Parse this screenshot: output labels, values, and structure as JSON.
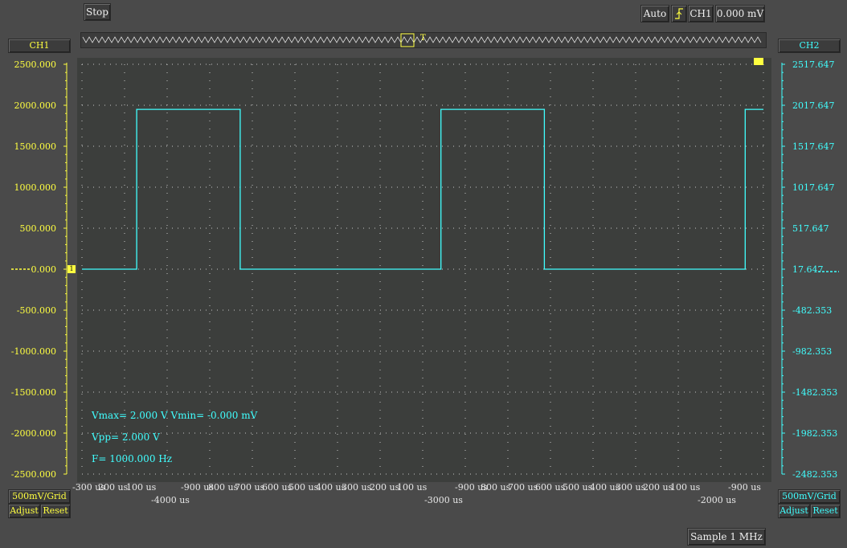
{
  "toolbar": {
    "stop_label": "Stop",
    "trigger_mode": "Auto",
    "trigger_edge_icon": "rising-edge-icon",
    "trigger_source": "CH1",
    "trigger_level": "0.000 mV"
  },
  "channels": {
    "ch1": {
      "label": "CH1",
      "scale": "500mV/Grid",
      "adjust": "Adjust",
      "reset": "Reset",
      "color": "#ffff40",
      "offset_marker": "1"
    },
    "ch2": {
      "label": "CH2",
      "scale": "500mV/Grid",
      "adjust": "Adjust",
      "reset": "Reset",
      "color": "#40ffff"
    }
  },
  "y_axis_left": [
    "2500.000",
    "2000.000",
    "1500.000",
    "1000.000",
    "500.000",
    "0.000",
    "-500.000",
    "-1000.000",
    "-1500.000",
    "-2000.000",
    "-2500.000"
  ],
  "y_axis_right": [
    "2517.647",
    "2017.647",
    "1517.647",
    "1017.647",
    "517.647",
    "17.647",
    "-482.353",
    "-982.353",
    "-1482.353",
    "-1982.353",
    "-2482.353"
  ],
  "x_axis_top": [
    "-300 us",
    "200 us",
    "100 us",
    "-900 us",
    "800 us",
    "700 us",
    "600 us",
    "500 us",
    "400 us",
    "300 us",
    "200 us",
    "100 us",
    "-900 us",
    "800 us",
    "700 us",
    "600 us",
    "500 us",
    "400 us",
    "300 us",
    "200 us",
    "100 us",
    "-900 us"
  ],
  "x_axis_major": [
    "-4000 us",
    "-3000 us",
    "-2000 us"
  ],
  "measurements": {
    "vmax_vmin": "Vmax= 2.000 V  Vmin= -0.000 mV",
    "vpp": "Vpp= 2.000 V",
    "freq": "F= 1000.000 Hz"
  },
  "status": {
    "sample_rate": "Sample 1 MHz"
  },
  "chart_data": {
    "type": "line",
    "series": [
      {
        "name": "CH1",
        "color": "#40ffff",
        "x": [
          -4320,
          -4140,
          -4140,
          -3800,
          -3800,
          -3140,
          -3140,
          -2800,
          -2800,
          -2140,
          -2140,
          -2080
        ],
        "y": [
          0,
          0,
          1950,
          1950,
          0,
          0,
          1950,
          1950,
          0,
          0,
          1950,
          1950
        ]
      }
    ],
    "xlim": [
      -4320,
      -2080
    ],
    "ylim": [
      -2500,
      2500
    ],
    "grid": true,
    "trace_color": "#40ffff"
  }
}
